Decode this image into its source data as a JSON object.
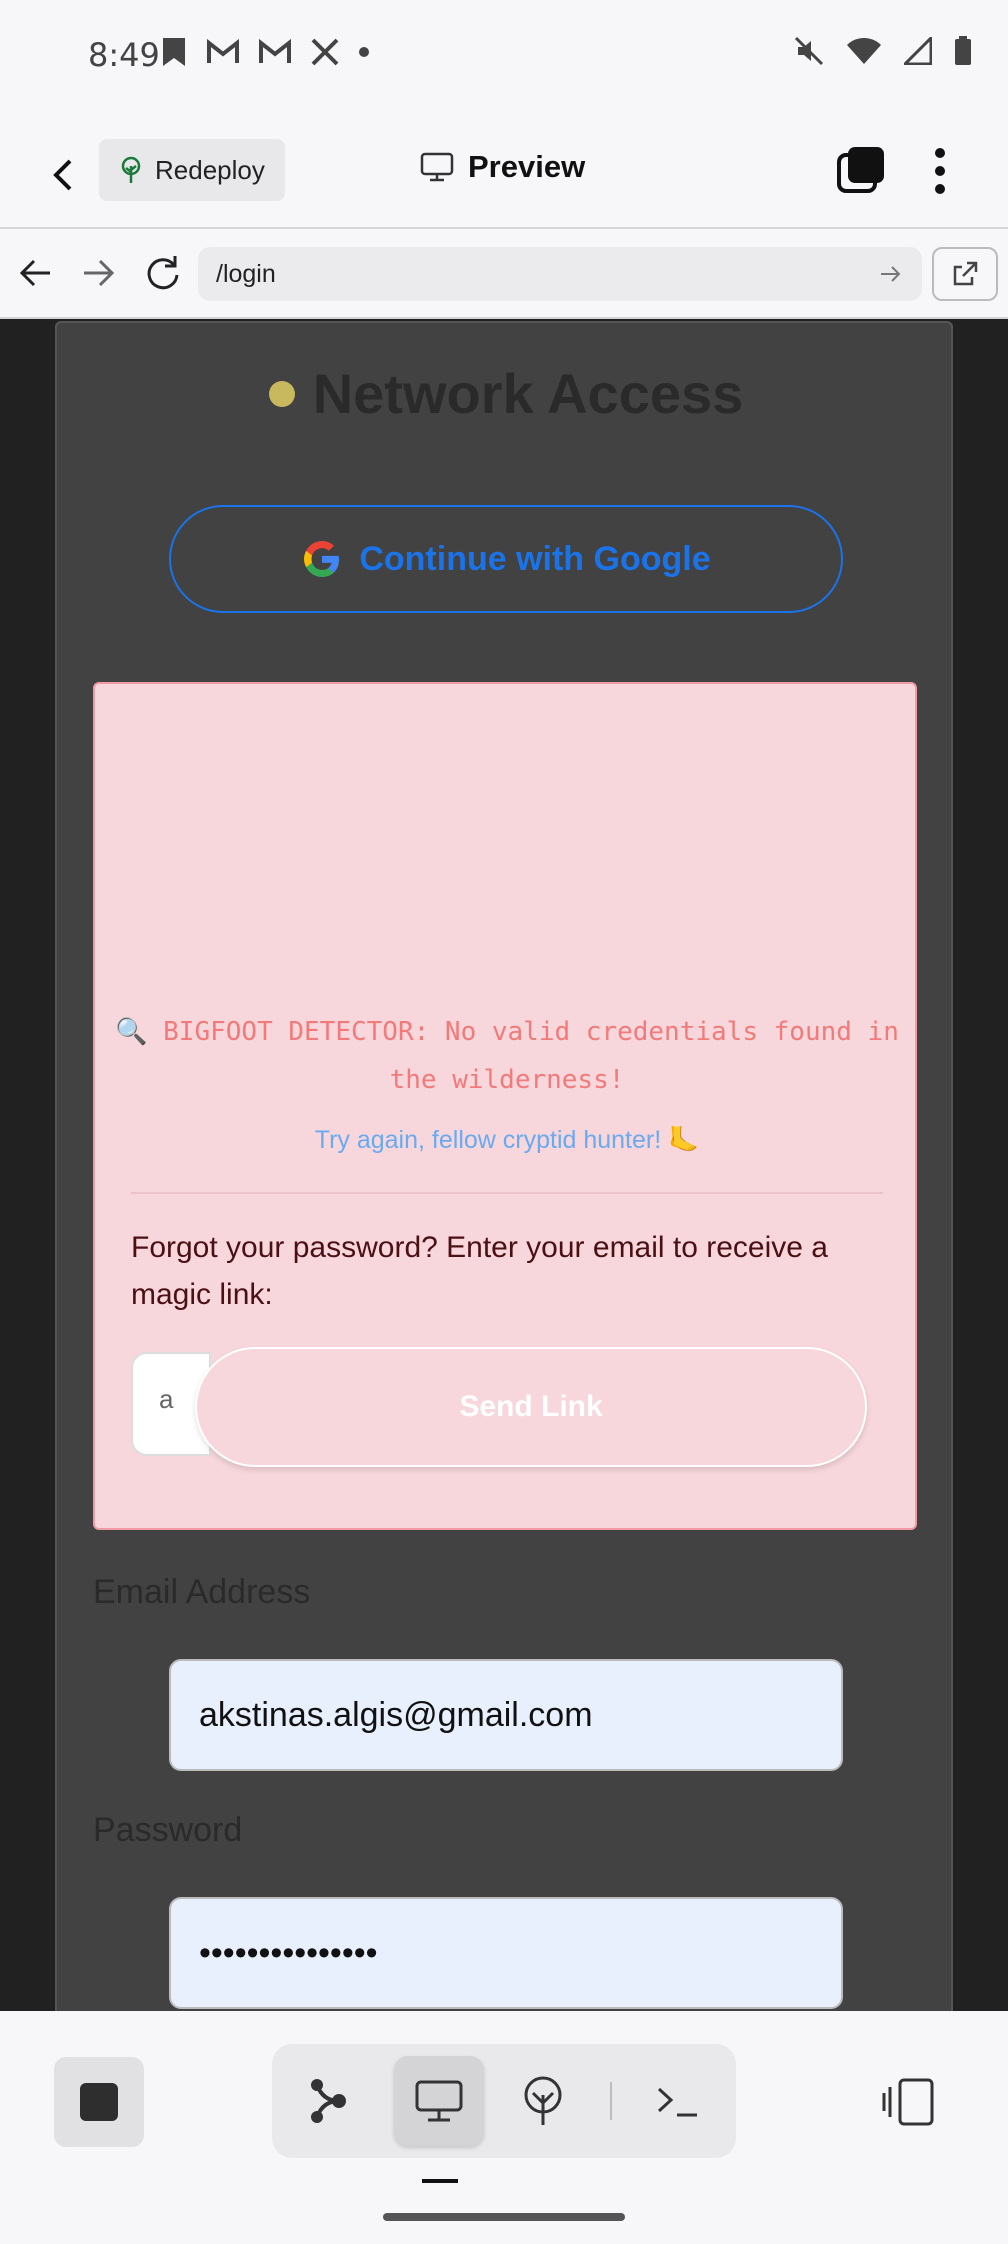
{
  "status_bar": {
    "time": "8:49"
  },
  "app_bar": {
    "redeploy_label": "Redeploy",
    "preview_label": "Preview"
  },
  "browser": {
    "url": "/login"
  },
  "login": {
    "title": "Network Access",
    "google_button": "Continue with Google",
    "error": {
      "bigfoot_message": "🔍 BIGFOOT DETECTOR: No valid credentials found in the wilderness!",
      "try_again": "Try again, fellow cryptid hunter! 🦶",
      "forgot_text": "Forgot your password? Enter your email to receive a magic link:",
      "email_partial": "a",
      "send_link": "Send Link"
    },
    "email_label": "Email Address",
    "email_value": "akstinas.algis@gmail.com",
    "password_label": "Password",
    "password_value": "•••••••••••••••"
  },
  "colors": {
    "google_blue": "#1a73e8",
    "alert_bg": "#f7d7db",
    "card_bg": "#424242"
  }
}
